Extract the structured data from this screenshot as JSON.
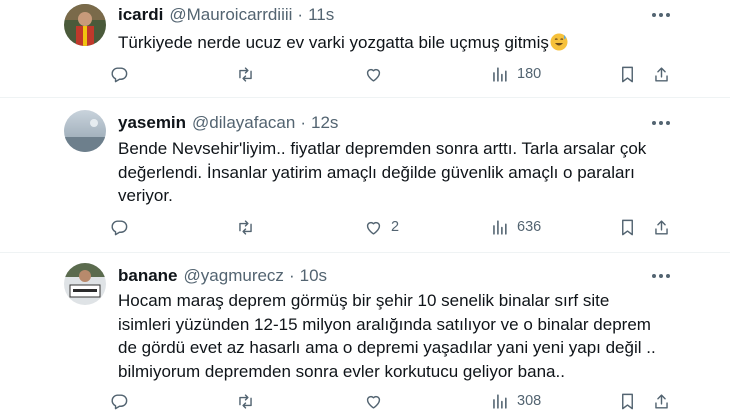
{
  "tweets": [
    {
      "display_name": "icardi",
      "handle": "@Mauroicarrdiiii",
      "separator": "·",
      "time": "11s",
      "text": "Türkiyede nerde ucuz ev varki yozgatta bile uçmuş gitmiş",
      "emoji": "sweat-smile-emoji",
      "reply_count": "",
      "retweet_count": "",
      "like_count": "",
      "view_count": "180"
    },
    {
      "display_name": "yasemin",
      "handle": "@dilayafacan",
      "separator": "·",
      "time": "12s",
      "text": "Bende Nevsehir'liyim.. fiyatlar depremden sonra arttı. Tarla arsalar çok değerlendi. İnsanlar yatirim amaçlı değilde güvenlik amaçlı o paraları veriyor.",
      "reply_count": "",
      "retweet_count": "",
      "like_count": "2",
      "view_count": "636"
    },
    {
      "display_name": "banane",
      "handle": "@yagmurecz",
      "separator": "·",
      "time": "10s",
      "text": "Hocam maraş deprem görmüş bir şehir 10 senelik binalar sırf site isimleri yüzünden 12-15 milyon aralığında satılıyor ve o binalar deprem de gördü evet az hasarlı ama o depremi yaşadılar yani yeni yapı değil .. bilmiyorum depremden sonra evler korkutucu geliyor bana..",
      "reply_count": "",
      "retweet_count": "",
      "like_count": "",
      "view_count": "308"
    }
  ],
  "icons": {
    "reply": "reply-icon",
    "retweet": "retweet-icon",
    "like": "heart-icon",
    "views": "views-chart-icon",
    "bookmark": "bookmark-icon",
    "share": "share-icon",
    "more": "more-options-icon"
  },
  "colors": {
    "text": "#0f1419",
    "secondary": "#536471",
    "divider": "#eff3f4"
  }
}
